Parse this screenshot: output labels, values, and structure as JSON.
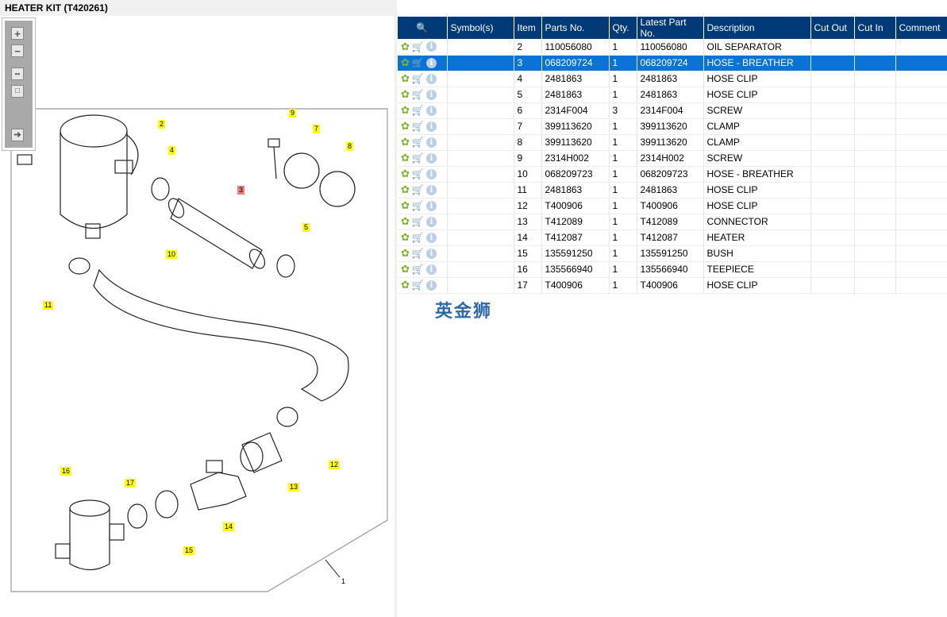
{
  "title": "HEATER KIT (T420261)",
  "toolbar": {
    "zoom_in": "+",
    "zoom_out": "−"
  },
  "watermark": "英金狮",
  "callouts": [
    {
      "label": "1"
    },
    {
      "label": "2"
    },
    {
      "label": "3"
    },
    {
      "label": "4"
    },
    {
      "label": "5"
    },
    {
      "label": "7"
    },
    {
      "label": "8"
    },
    {
      "label": "9"
    },
    {
      "label": "10"
    },
    {
      "label": "11"
    },
    {
      "label": "12"
    },
    {
      "label": "13"
    },
    {
      "label": "14"
    },
    {
      "label": "15"
    },
    {
      "label": "16"
    },
    {
      "label": "17"
    }
  ],
  "table": {
    "columns": [
      "Symbol(s)",
      "Item",
      "Parts No.",
      "Qty.",
      "Latest Part No.",
      "Description",
      "Cut Out",
      "Cut In",
      "Comment"
    ],
    "selected_item": "3",
    "rows": [
      {
        "item": "2",
        "part": "110056080",
        "qty": "1",
        "latest": "110056080",
        "desc": "OIL SEPARATOR"
      },
      {
        "item": "3",
        "part": "068209724",
        "qty": "1",
        "latest": "068209724",
        "desc": "HOSE - BREATHER"
      },
      {
        "item": "4",
        "part": "2481863",
        "qty": "1",
        "latest": "2481863",
        "desc": "HOSE CLIP"
      },
      {
        "item": "5",
        "part": "2481863",
        "qty": "1",
        "latest": "2481863",
        "desc": "HOSE CLIP"
      },
      {
        "item": "6",
        "part": "2314F004",
        "qty": "3",
        "latest": "2314F004",
        "desc": "SCREW"
      },
      {
        "item": "7",
        "part": "399113620",
        "qty": "1",
        "latest": "399113620",
        "desc": "CLAMP"
      },
      {
        "item": "8",
        "part": "399113620",
        "qty": "1",
        "latest": "399113620",
        "desc": "CLAMP"
      },
      {
        "item": "9",
        "part": "2314H002",
        "qty": "1",
        "latest": "2314H002",
        "desc": "SCREW"
      },
      {
        "item": "10",
        "part": "068209723",
        "qty": "1",
        "latest": "068209723",
        "desc": "HOSE - BREATHER"
      },
      {
        "item": "11",
        "part": "2481863",
        "qty": "1",
        "latest": "2481863",
        "desc": "HOSE CLIP"
      },
      {
        "item": "12",
        "part": "T400906",
        "qty": "1",
        "latest": "T400906",
        "desc": "HOSE CLIP"
      },
      {
        "item": "13",
        "part": "T412089",
        "qty": "1",
        "latest": "T412089",
        "desc": "CONNECTOR"
      },
      {
        "item": "14",
        "part": "T412087",
        "qty": "1",
        "latest": "T412087",
        "desc": "HEATER"
      },
      {
        "item": "15",
        "part": "135591250",
        "qty": "1",
        "latest": "135591250",
        "desc": "BUSH"
      },
      {
        "item": "16",
        "part": "135566940",
        "qty": "1",
        "latest": "135566940",
        "desc": "TEEPIECE"
      },
      {
        "item": "17",
        "part": "T400906",
        "qty": "1",
        "latest": "T400906",
        "desc": "HOSE CLIP"
      }
    ]
  }
}
